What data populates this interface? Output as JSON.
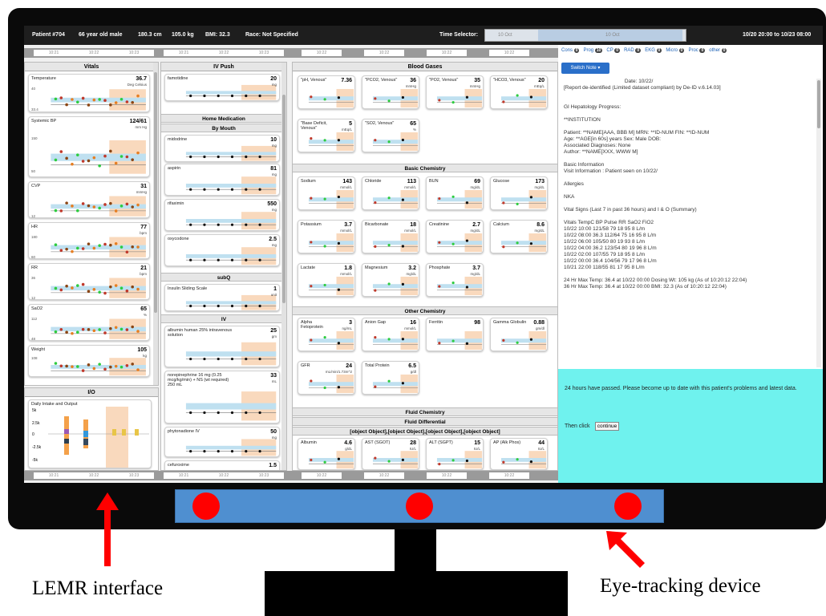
{
  "topbar": {
    "patient": "Patient #704",
    "age": "66 year old male",
    "height": "180.3 cm",
    "weight": "105.0 kg",
    "bmi": "BMI: 32.3",
    "race": "Race: Not Specified",
    "time_selector_label": "Time Selector:",
    "range": "10/20 20:00 to 10/23 08:00",
    "slider_left": "10 Oct",
    "slider_right": "10 Oct"
  },
  "time_ticks": {
    "a": "10:21",
    "b": "10:22",
    "c": "10:23",
    "d": "10:22"
  },
  "vitals": {
    "title": "Vitals",
    "cards": [
      {
        "t": "Temperature",
        "v": "36.7",
        "u": "Deg Celsius",
        "ymax": "40",
        "ymin": "33.4"
      },
      {
        "t": "Systemic BP",
        "v": "124/61",
        "u": "mm Hg",
        "ymax": "150",
        "ymin": "50"
      },
      {
        "t": "CVP",
        "v": "31",
        "u": "mmHg",
        "ymax": "",
        "ymin": "12"
      },
      {
        "t": "HR",
        "v": "77",
        "u": "bpm",
        "ymax": "180",
        "ymin": "60"
      },
      {
        "t": "RR",
        "v": "21",
        "u": "bpm",
        "ymax": "36",
        "ymin": "12"
      },
      {
        "t": "SaO2",
        "v": "65",
        "u": "%",
        "ymax": "112",
        "ymin": "48"
      },
      {
        "t": "Weight",
        "v": "105",
        "u": "kg",
        "ymax": "108",
        "ymin": ""
      }
    ]
  },
  "io": {
    "title": "I/O",
    "card": "Daily Intake and Output",
    "ticks": [
      "5k",
      "2.5k",
      "0",
      "-2.5k",
      "-5k"
    ]
  },
  "meds": {
    "iv_push": "IV Push",
    "home": "Home Medication",
    "by_mouth": "By Mouth",
    "subq": "subQ",
    "iv": "IV",
    "cards": [
      {
        "t": "famotidine",
        "v": "20",
        "u": "mg"
      },
      {
        "t": "midodrine",
        "v": "10",
        "u": "mg"
      },
      {
        "t": "aspirin",
        "v": "81",
        "u": "mg"
      },
      {
        "t": "rifaximin",
        "v": "550",
        "u": "mg"
      },
      {
        "t": "oxycodone",
        "v": "2.5",
        "u": "mg"
      },
      {
        "t": "Insulin Sliding Scale",
        "v": "1",
        "u": "unit"
      },
      {
        "t": "albumin human 25% intravenous solution",
        "v": "25",
        "u": "gm"
      },
      {
        "t": "norepinephrine 16 mg (0.25 mcg/kg/min) + NS (wt required) 250 mL",
        "v": "33",
        "u": "mL"
      },
      {
        "t": "phytonadione IV",
        "v": "50",
        "u": "mg"
      },
      {
        "t": "cefuroxime",
        "v": "1.5",
        "u": "gm"
      }
    ]
  },
  "labs": {
    "blood_gases": "Blood Gases",
    "basic_chem": "Basic Chemistry",
    "other_chem": "Other Chemistry",
    "fluid_chem": "Fluid Chemistry",
    "fluid_diff": "Fluid Differential",
    "liver": [
      {
        "t": "Albumin",
        "v": "4.6",
        "u": "g/dL"
      },
      {
        "t": "AST (SGOT)",
        "v": "28",
        "u": "IU/L"
      },
      {
        "t": "ALT (SGPT)",
        "v": "15",
        "u": "IU/L"
      },
      {
        "t": "AP (Alk Phos)",
        "v": "44",
        "u": "IU/L"
      }
    ],
    "bg": [
      {
        "t": "\"pH, Venous\"",
        "v": "7.36",
        "u": ""
      },
      {
        "t": "\"PCO2, Venous\"",
        "v": "36",
        "u": "mmHg"
      },
      {
        "t": "\"PO2, Venous\"",
        "v": "35",
        "u": "mmHg"
      },
      {
        "t": "\"HCO3, Venous\"",
        "v": "20",
        "u": "mEq/L"
      },
      {
        "t": "\"Base Deficit, Venous\"",
        "v": "5",
        "u": "mEq/L"
      },
      {
        "t": "\"SO2, Venous\"",
        "v": "65",
        "u": "%"
      }
    ],
    "basic": [
      {
        "t": "Sodium",
        "v": "143",
        "u": "mmol/L"
      },
      {
        "t": "Chloride",
        "v": "113",
        "u": "mmol/L"
      },
      {
        "t": "BUN",
        "v": "69",
        "u": "mg/dL"
      },
      {
        "t": "Glucose",
        "v": "173",
        "u": "mg/dL"
      },
      {
        "t": "Potassium",
        "v": "3.7",
        "u": "mmol/L"
      },
      {
        "t": "Bicarbonate",
        "v": "18",
        "u": "mmol/L"
      },
      {
        "t": "Creatinine",
        "v": "2.7",
        "u": "mg/dL"
      },
      {
        "t": "Calcium",
        "v": "8.6",
        "u": "mg/dL"
      },
      {
        "t": "Lactate",
        "v": "1.8",
        "u": "mmol/L"
      },
      {
        "t": "Magnesium",
        "v": "3.2",
        "u": "mg/dL"
      },
      {
        "t": "Phosphate",
        "v": "3.7",
        "u": "mg/dL"
      }
    ],
    "other": [
      {
        "t": "Alpha Fetoprotein",
        "v": "3",
        "u": "ng/mL"
      },
      {
        "t": "Anion Gap",
        "v": "16",
        "u": "mmol/L"
      },
      {
        "t": "Ferritin",
        "v": "98",
        "u": ""
      },
      {
        "t": "Gamma Globulin",
        "v": "0.88",
        "u": "gm/dl"
      },
      {
        "t": "GFR",
        "v": "24",
        "u": "mL/min/1.73m^2"
      },
      {
        "t": "Total Protein",
        "v": "6.5",
        "u": "g/dl"
      }
    ]
  },
  "note": {
    "tabs": [
      {
        "l": "Cons",
        "n": "0"
      },
      {
        "l": "Prog",
        "n": "10"
      },
      {
        "l": "CP",
        "n": "0"
      },
      {
        "l": "RAD",
        "n": "0"
      },
      {
        "l": "EKG",
        "n": "0"
      },
      {
        "l": "Micro",
        "n": "0"
      },
      {
        "l": "Proc",
        "n": "0"
      },
      {
        "l": "other",
        "n": "0"
      }
    ],
    "switch": "Switch Note ▾",
    "lines": [
      "                                          Date: 10/22/",
      "[Report de-identified (Limited dataset compliant) by De-ID v.6.14.03]",
      "",
      "",
      "GI Hepatology Progress:",
      "",
      "**INSTITUTION",
      "",
      "Patient: **NAME[AAA, BBB M] MRN: **ID-NUM FIN: **ID-NUM",
      "Age: **AGE[in 60s] years Sex: Male DOB:",
      "Associated Diagnoses: None",
      "Author: **NAME[XXX, WWW M]",
      "",
      "Basic Information",
      "Visit Information : Patient seen on 10/22/",
      "",
      "Allergies",
      "",
      "NKA",
      "",
      "Vital Signs (Last 7 in past 36 hours) and I & O (Summary)",
      "",
      "Vitals TempC BP Pulse RR SaO2 FiO2",
      "10/22 10:00 121/58 79 18 95 8 L/m",
      "10/22 08:00 36.3 112/64 75 16 95 8 L/m",
      "10/22 06:00 105/50 80 19 93 8 L/m",
      "10/22 04:00 36.2 123/54 80 19 96 8 L/m",
      "10/22 02:00 107/55 79 18 95 8 L/m",
      "10/22 00:00 36.4 104/56 79 17 96 8 L/m",
      "10/21 22:00 118/55 81 17 95 8 L/m",
      "",
      "24 Hr Max Temp: 36.4 at 10/22 00:00 Dosing Wt: 105 kg (As of 10:20:12 22:04)",
      "36 Hr Max Temp: 36.4 at 10/22 00:00 BMI: 32.3 (As of 10:20:12 22:04)"
    ]
  },
  "prompt": {
    "message": "24 hours have passed. Please become up to date with this patient's problems and latest data.",
    "then": "Then click",
    "button": "continue"
  },
  "labels": {
    "left": "LEMR interface",
    "right": "Eye-tracking device"
  },
  "colors": {
    "monitor": "#0a0a0a",
    "bar": "#4f8fd0",
    "dot": "#ff0000",
    "prompt": "#6ff2ee",
    "range": "#f9d9bd",
    "norm": "#bfe0f0"
  }
}
